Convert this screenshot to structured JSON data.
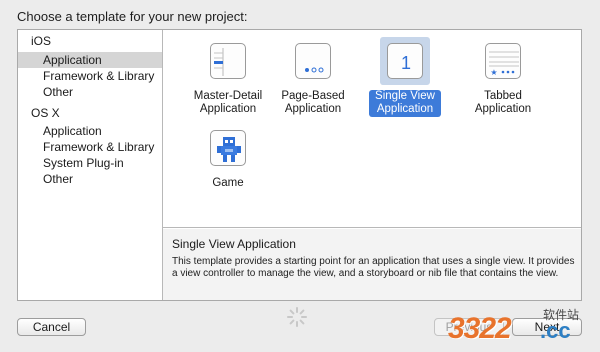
{
  "header": {
    "title": "Choose a template for your new project:"
  },
  "sidebar": {
    "rows": [
      {
        "label": "iOS",
        "kind": "category",
        "selected": false
      },
      {
        "label": "Application",
        "kind": "item",
        "selected": true
      },
      {
        "label": "Framework & Library",
        "kind": "item",
        "selected": false
      },
      {
        "label": "Other",
        "kind": "item",
        "selected": false
      },
      {
        "label": "OS X",
        "kind": "category",
        "selected": false
      },
      {
        "label": "Application",
        "kind": "item",
        "selected": false
      },
      {
        "label": "Framework & Library",
        "kind": "item",
        "selected": false
      },
      {
        "label": "System Plug-in",
        "kind": "item",
        "selected": false
      },
      {
        "label": "Other",
        "kind": "item",
        "selected": false
      }
    ]
  },
  "templates": [
    {
      "label": "Master-Detail Application",
      "icon": "master-detail-icon",
      "selected": false
    },
    {
      "label": "Page-Based Application",
      "icon": "page-based-icon",
      "selected": false
    },
    {
      "label": "Single View Application",
      "icon": "single-view-icon",
      "selected": true,
      "badge": "1"
    },
    {
      "label": "Tabbed Application",
      "icon": "tabbed-icon",
      "selected": false
    },
    {
      "label": "Game",
      "icon": "game-robot-icon",
      "selected": false
    }
  ],
  "description": {
    "title": "Single View Application",
    "text": "This template provides a starting point for an application that uses a single view. It provides a view controller to manage the view, and a storyboard or nib file that contains the view."
  },
  "buttons": {
    "cancel": "Cancel",
    "previous": "Previous",
    "next": "Next"
  },
  "watermark": {
    "number": "3322",
    "domain": ".cc",
    "site": "软件站"
  },
  "colors": {
    "selection": "#3d7bd9",
    "sidebar_selection": "#d5d5d5",
    "watermark_orange": "#e8732c",
    "watermark_blue": "#2d7fc4"
  }
}
